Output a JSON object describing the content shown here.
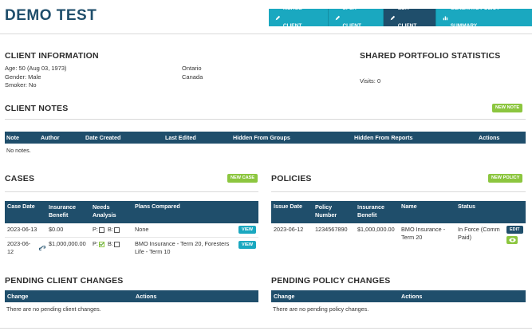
{
  "header": {
    "title": "DEMO TEST",
    "buttons": [
      "MERGE CLIENT",
      "SPLIT CLIENT",
      "EDIT CLIENT",
      "GENERATE POLICY SUMMARY"
    ]
  },
  "client_information": {
    "title": "CLIENT INFORMATION",
    "age": "Age: 50 (Aug 03, 1973)",
    "gender": "Gender: Male",
    "smoker": "Smoker: No",
    "province": "Ontario",
    "country": "Canada"
  },
  "shared_portfolio": {
    "title": "SHARED PORTFOLIO STATISTICS",
    "visits": "Visits: 0"
  },
  "client_notes": {
    "title": "CLIENT NOTES",
    "new_button": "NEW NOTE",
    "columns": [
      "Note",
      "Author",
      "Date Created",
      "Last Edited",
      "Hidden From Groups",
      "Hidden From Reports",
      "Actions"
    ],
    "empty": "No notes."
  },
  "cases": {
    "title": "CASES",
    "new_button": "NEW CASE",
    "columns": [
      "Case Date",
      "Insurance Benefit",
      "Needs Analysis",
      "Plans Compared"
    ],
    "rows": [
      {
        "date": "2023-06-13",
        "benefit": "$0.00",
        "p_label": "P:",
        "b_label": "B:",
        "p_checked": false,
        "b_checked": false,
        "plans": "None",
        "action": "VIEW"
      },
      {
        "date": "2023-06-12",
        "benefit": "$1,000,000.00",
        "p_label": "P:",
        "b_label": "B:",
        "p_checked": true,
        "b_checked": false,
        "plans": "BMO Insurance - Term 20, Foresters Life - Term 10",
        "action": "VIEW"
      }
    ]
  },
  "policies": {
    "title": "POLICIES",
    "new_button": "NEW POLICY",
    "columns": [
      "Issue Date",
      "Policy Number",
      "Insurance Benefit",
      "Name",
      "Status"
    ],
    "rows": [
      {
        "date": "2023-06-12",
        "number": "1234567890",
        "benefit": "$1,000,000.00",
        "name": "BMO Insurance - Term 20",
        "status": "In Force (Comm Paid)",
        "action": "EDIT"
      }
    ]
  },
  "pending_client": {
    "title": "PENDING CLIENT CHANGES",
    "columns": [
      "Change",
      "Actions"
    ],
    "empty": "There are no pending client changes."
  },
  "pending_policy": {
    "title": "PENDING POLICY CHANGES",
    "columns": [
      "Change",
      "Actions"
    ],
    "empty": "There are no pending policy changes."
  },
  "colors": {
    "navy": "#1f4e6b",
    "teal": "#1aa8c0",
    "green": "#8cc63f"
  }
}
